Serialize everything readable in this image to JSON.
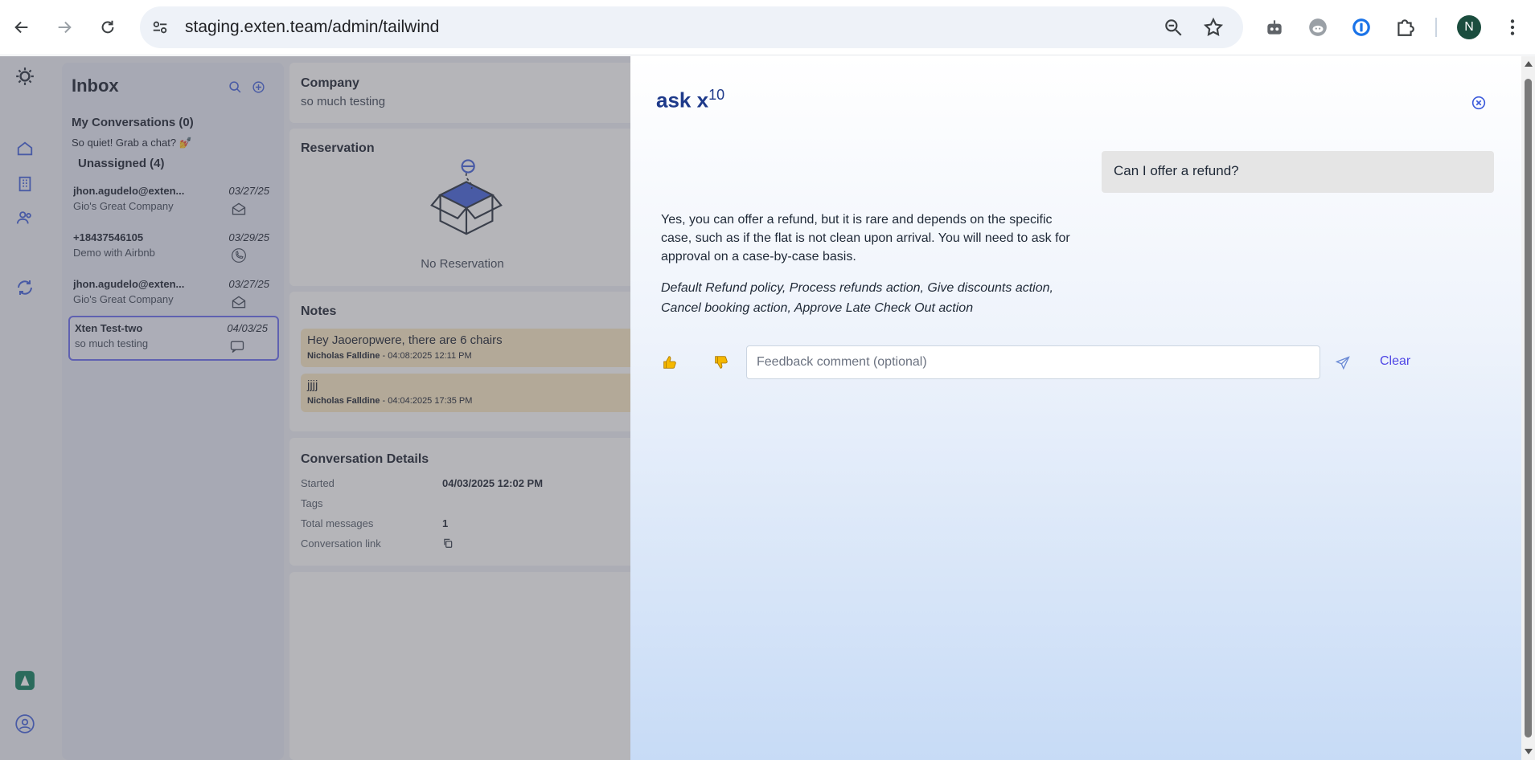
{
  "browser": {
    "url": "staging.exten.team/admin/tailwind",
    "avatar_letter": "N"
  },
  "inbox": {
    "title": "Inbox",
    "my_conversations": "My Conversations (0)",
    "quiet_message": "So quiet! Grab a chat? 💅",
    "unassigned": "Unassigned (4)",
    "conversations": [
      {
        "name": "jhon.agudelo@exten...",
        "sub": "Gio's Great Company",
        "date": "03/27/25",
        "icon": "email-icon"
      },
      {
        "name": "+18437546105",
        "sub": "Demo with Airbnb",
        "date": "03/29/25",
        "icon": "phone-icon"
      },
      {
        "name": "jhon.agudelo@exten...",
        "sub": "Gio's Great Company",
        "date": "03/27/25",
        "icon": "email-icon"
      },
      {
        "name": "Xten Test-two",
        "sub": "so much testing",
        "date": "04/03/25",
        "icon": "sms-icon"
      }
    ]
  },
  "company": {
    "title": "Company",
    "value": "so much testing"
  },
  "reservation": {
    "title": "Reservation",
    "empty": "No Reservation"
  },
  "notes": {
    "title": "Notes",
    "items": [
      {
        "text": "Hey Jaoeropwere, there are 6 chairs",
        "author": "Nicholas Falldine",
        "time": " - 04:08:2025 12:11 PM"
      },
      {
        "text": "jjjj",
        "author": "Nicholas Falldine",
        "time": " - 04:04:2025 17:35 PM"
      }
    ]
  },
  "details": {
    "title": "Conversation Details",
    "started_label": "Started",
    "started_value": "04/03/2025 12:02 PM",
    "tags_label": "Tags",
    "total_label": "Total messages",
    "total_value": "1",
    "link_label": "Conversation link"
  },
  "ask_panel": {
    "title": "ask x",
    "title_sup": "10",
    "question": "Can I offer a refund?",
    "answer": "Yes, you can offer a refund, but it is rare and depends on the specific case, such as if the flat is not clean upon arrival. You will need to ask for approval on a case-by-case basis.",
    "sources": "Default Refund policy, Process refunds action, Give discounts action, Cancel booking action, Approve Late Check Out action",
    "feedback_placeholder": "Feedback comment (optional)",
    "clear_label": "Clear"
  }
}
